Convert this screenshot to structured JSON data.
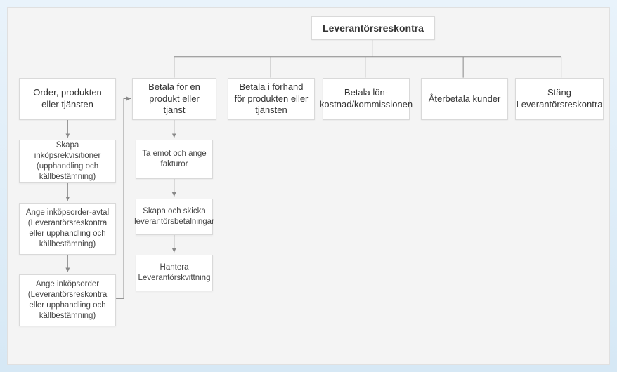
{
  "root": {
    "label": "Leverantörsreskontra"
  },
  "left_col": {
    "head": "Order, produkten eller tjänsten",
    "steps": [
      "Skapa inköpsrekvisitioner (upphandling och källbestämning)",
      "Ange inköpsorder-avtal (Leverantörsreskontra eller upphandling och källbestämning)",
      "Ange inköpsorder (Leverantörsreskontra eller upphandling och källbestämning)"
    ]
  },
  "branches": [
    {
      "head": "Betala för en produkt eller tjänst",
      "steps": [
        "Ta emot och ange fakturor",
        "Skapa och skicka leverantörsbetalningar",
        "Hantera Leverantörskvittning"
      ]
    },
    {
      "head": "Betala i förhand för produkten eller tjänsten",
      "steps": []
    },
    {
      "head": "Betala lön-kostnad/kommissionen",
      "steps": []
    },
    {
      "head": "Återbetala kunder",
      "steps": []
    },
    {
      "head": "Stäng Leverantörsreskontra",
      "steps": []
    }
  ]
}
